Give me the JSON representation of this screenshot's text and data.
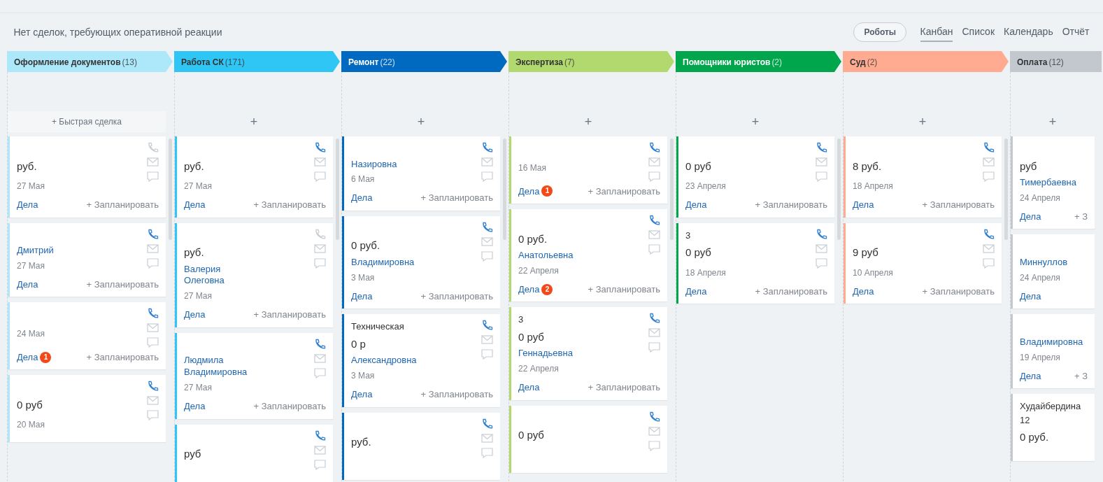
{
  "notice": "Нет сделок, требующих оперативной реакции",
  "robots_button": "Роботы",
  "views": [
    {
      "label": "Канбан",
      "selected": true
    },
    {
      "label": "Список",
      "selected": false
    },
    {
      "label": "Календарь",
      "selected": false
    },
    {
      "label": "Отчёт",
      "selected": false
    }
  ],
  "columns": [
    {
      "name": "Оформление документов",
      "count": "(13)",
      "color": "#ade8fa",
      "quick_add": "+ Быстрая сделка",
      "cards": [
        {
          "price": "руб.",
          "date": "27 Мая",
          "phone_active": false,
          "tasks": "Дела",
          "plan": "+ Запланировать"
        },
        {
          "contacts": [
            "Дмитрий"
          ],
          "date": "27 Мая",
          "phone_active": true,
          "tasks": "Дела",
          "plan": "+ Запланировать"
        },
        {
          "date": "24 Мая",
          "phone_active": true,
          "tasks": "Дела",
          "badge": "1",
          "plan": "+ Запланировать"
        },
        {
          "price": "0 руб",
          "date": "20 Мая",
          "phone_active": true
        }
      ]
    },
    {
      "name": "Работа СК",
      "count": "(171)",
      "color": "#2fc6f6",
      "quick_add": "+",
      "cards": [
        {
          "price": "руб.",
          "date": "27 Мая",
          "phone_active": true,
          "tasks": "Дела",
          "plan": "+ Запланировать"
        },
        {
          "price": "руб.",
          "contacts": [
            "Валерия",
            "Олеговна"
          ],
          "date": "27 Мая",
          "phone_active": false,
          "tasks": "Дела",
          "plan": "+ Запланировать"
        },
        {
          "contacts": [
            "Людмила",
            "Владимировна"
          ],
          "date": "27 Мая",
          "phone_active": true,
          "tasks": "Дела",
          "plan": "+ Запланировать"
        },
        {
          "price": "руб",
          "phone_active": true
        }
      ]
    },
    {
      "name": "Ремонт",
      "count": "(22)",
      "color": "#0069c0",
      "quick_add": "+",
      "cards": [
        {
          "contacts": [
            "Назировна"
          ],
          "date": "6 Мая",
          "phone_active": true,
          "tasks": "Дела",
          "plan": "+ Запланировать"
        },
        {
          "price": "0 руб.",
          "contacts": [
            "Владимировна"
          ],
          "date": "3 Мая",
          "phone_active": true,
          "tasks": "Дела",
          "plan": "+ Запланировать"
        },
        {
          "title": "Техническая",
          "price": "0 р",
          "contacts": [
            "Александровна"
          ],
          "date": "3 Мая",
          "phone_active": true,
          "tasks": "Дела",
          "plan": "+ Запланировать"
        },
        {
          "price": "руб.",
          "phone_active": true
        }
      ]
    },
    {
      "name": "Экспертиза",
      "count": "(7)",
      "color": "#b2d96e",
      "quick_add": "+",
      "cards": [
        {
          "date": "16 Мая",
          "phone_active": true,
          "tasks": "Дела",
          "badge": "1",
          "plan": "+ Запланировать"
        },
        {
          "price": "0 руб.",
          "contacts": [
            "Анатольевна"
          ],
          "date": "22 Апреля",
          "phone_active": true,
          "tasks": "Дела",
          "badge": "2",
          "plan": "+ Запланировать"
        },
        {
          "title": "3",
          "price": "0 руб",
          "contacts": [
            "Геннадьевна"
          ],
          "date": "22 Апреля",
          "phone_active": true,
          "tasks": "Дела",
          "plan": "+ Запланировать"
        },
        {
          "price": "0 руб",
          "phone_active": true
        }
      ]
    },
    {
      "name": "Помощники юристов",
      "count": "(2)",
      "color": "#00a64c",
      "quick_add": "+",
      "cards": [
        {
          "price": "0 руб",
          "date": "23 Апреля",
          "phone_active": true,
          "tasks": "Дела",
          "plan": "+ Запланировать"
        },
        {
          "title": "3",
          "price": "0 руб",
          "date": "18 Апреля",
          "phone_active": true,
          "tasks": "Дела",
          "plan": "+ Запланировать"
        }
      ]
    },
    {
      "name": "Суд",
      "count": "(2)",
      "color": "#ffab91",
      "quick_add": "+",
      "cards": [
        {
          "price": "8 руб.",
          "date": "18 Апреля",
          "phone_active": true,
          "tasks": "Дела",
          "plan": "+ Запланировать"
        },
        {
          "price": "9 руб",
          "date": "10 Апреля",
          "phone_active": true,
          "tasks": "Дела",
          "plan": "+ Запланировать"
        }
      ]
    },
    {
      "name": "Оплата",
      "count": "(12)",
      "color": "#c3c8cf",
      "quick_add": "+",
      "cards": [
        {
          "price": "руб",
          "contacts": [
            "Тимербаевна"
          ],
          "date": "24 Апреля",
          "tasks": "Дела",
          "plan": "+ З"
        },
        {
          "contacts": [
            "Миннуллов"
          ],
          "date": "24 Апреля",
          "tasks": "Дела"
        },
        {
          "contacts": [
            "Владимировна"
          ],
          "date": "19 Апреля",
          "tasks": "Дела",
          "plan": "+ З"
        },
        {
          "title": "Худайбердина 12",
          "price": "0 руб."
        }
      ]
    }
  ]
}
